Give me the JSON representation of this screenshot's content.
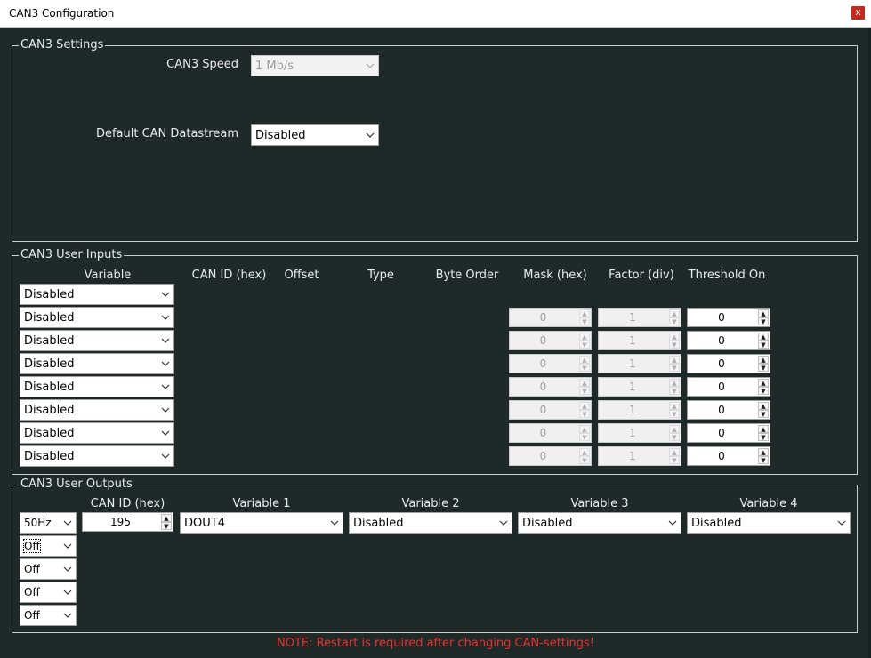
{
  "window": {
    "title": "CAN3 Configuration",
    "close_label": "x"
  },
  "settings": {
    "legend": "CAN3 Settings",
    "speed_label": "CAN3 Speed",
    "speed_value": "1 Mb/s",
    "datastream_label": "Default CAN Datastream",
    "datastream_value": "Disabled"
  },
  "inputs": {
    "legend": "CAN3 User Inputs",
    "headers": {
      "variable": "Variable",
      "can_id": "CAN ID (hex)",
      "offset": "Offset",
      "type": "Type",
      "byte_order": "Byte Order",
      "mask": "Mask (hex)",
      "factor": "Factor (div)",
      "threshold": "Threshold On"
    },
    "rows": [
      {
        "variable": "Disabled"
      },
      {
        "variable": "Disabled",
        "mask": "0",
        "factor": "1",
        "threshold": "0"
      },
      {
        "variable": "Disabled",
        "mask": "0",
        "factor": "1",
        "threshold": "0"
      },
      {
        "variable": "Disabled",
        "mask": "0",
        "factor": "1",
        "threshold": "0"
      },
      {
        "variable": "Disabled",
        "mask": "0",
        "factor": "1",
        "threshold": "0"
      },
      {
        "variable": "Disabled",
        "mask": "0",
        "factor": "1",
        "threshold": "0"
      },
      {
        "variable": "Disabled",
        "mask": "0",
        "factor": "1",
        "threshold": "0"
      },
      {
        "variable": "Disabled",
        "mask": "0",
        "factor": "1",
        "threshold": "0"
      }
    ]
  },
  "outputs": {
    "legend": "CAN3 User Outputs",
    "headers": {
      "can_id": "CAN ID (hex)",
      "var1": "Variable 1",
      "var2": "Variable 2",
      "var3": "Variable 3",
      "var4": "Variable 4"
    },
    "rate": "50Hz",
    "can_id": "195",
    "var1": "DOUT4",
    "var2": "Disabled",
    "var3": "Disabled",
    "var4": "Disabled",
    "extra_rates": [
      "Off",
      "Off",
      "Off",
      "Off"
    ]
  },
  "note": "NOTE: Restart is required after changing CAN-settings!",
  "icons": {
    "chevron": "chevron-down-icon",
    "spin_up": "▲",
    "spin_down": "▼"
  }
}
